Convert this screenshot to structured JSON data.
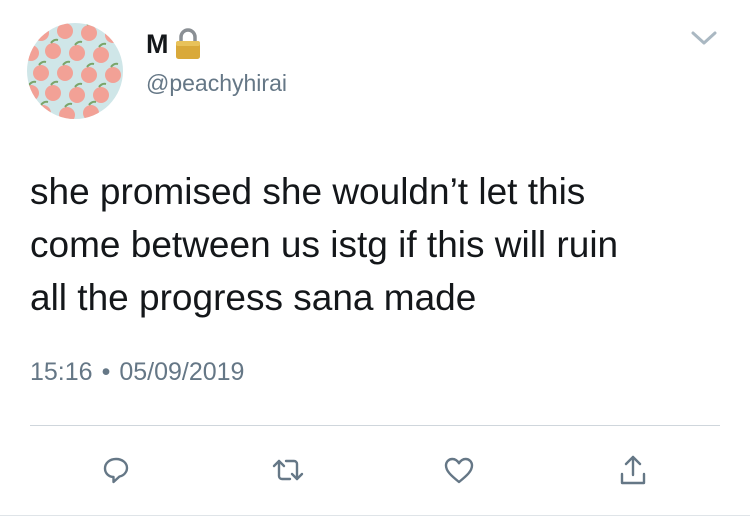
{
  "author": {
    "display_name": "M",
    "handle": "@peachyhirai",
    "protected_icon": "lock-icon",
    "avatar_pattern": "peaches",
    "avatar_bg": "#cfe6e8"
  },
  "tweet": {
    "text": "she promised she wouldn’t let this\ncome between us istg if this will ruin\nall the progress sana made",
    "time": "15:16",
    "separator": "•",
    "date": "05/09/2019"
  },
  "actions": [
    {
      "name": "reply",
      "icon": "reply-icon"
    },
    {
      "name": "retweet",
      "icon": "retweet-icon"
    },
    {
      "name": "like",
      "icon": "heart-icon"
    },
    {
      "name": "share",
      "icon": "share-icon"
    }
  ],
  "more_menu_icon": "chevron-down-icon",
  "colors": {
    "text": "#14171a",
    "secondary": "#657786",
    "icon": "#657786",
    "peach": "#f2a196",
    "divider": "#cfd6dc"
  }
}
